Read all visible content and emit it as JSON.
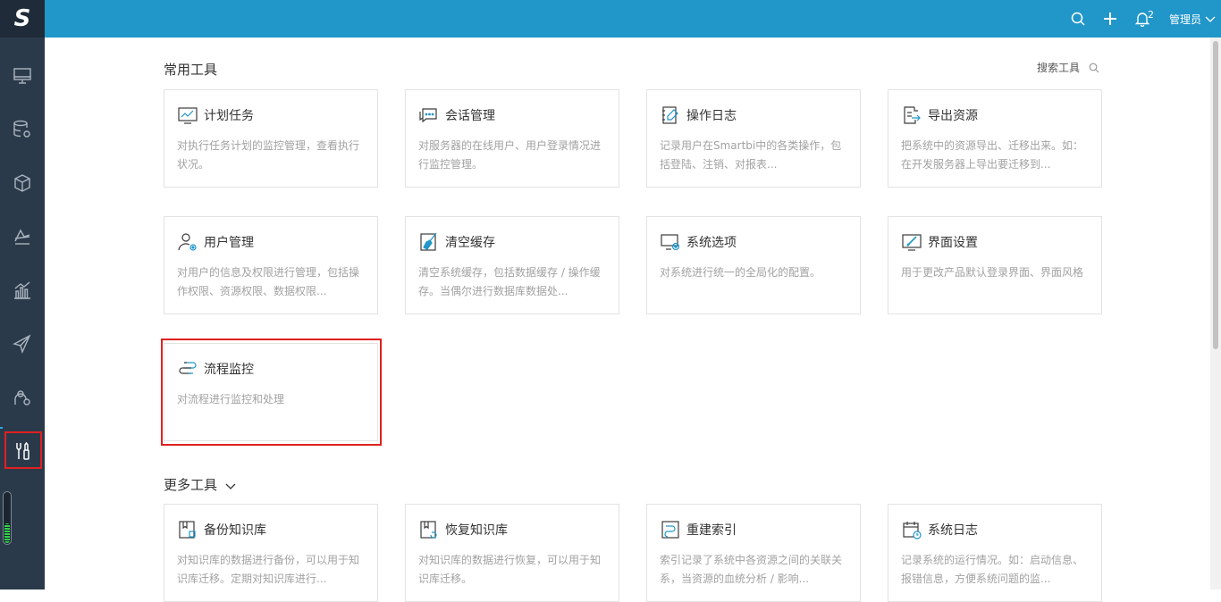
{
  "logo": "S",
  "topbar": {
    "user_name": "管理员",
    "notification_count": "2"
  },
  "sidebar": {
    "items": [
      {
        "name": "monitor-icon"
      },
      {
        "name": "database-settings-icon"
      },
      {
        "name": "cube-icon"
      },
      {
        "name": "analysis-icon"
      },
      {
        "name": "bar-chart-icon"
      },
      {
        "name": "paper-plane-icon"
      },
      {
        "name": "user-graph-icon"
      },
      {
        "name": "tools-icon"
      }
    ]
  },
  "common_tools": {
    "title": "常用工具",
    "search_label": "搜索工具",
    "cards": [
      {
        "title": "计划任务",
        "desc": "对执行任务计划的监控管理，查看执行状况。",
        "icon": "chart-screen-icon"
      },
      {
        "title": "会话管理",
        "desc": "对服务器的在线用户、用户登录情况进行监控管理。",
        "icon": "chat-icon"
      },
      {
        "title": "操作日志",
        "desc": "记录用户在Smartbi中的各类操作，包括登陆、注销、对报表...",
        "icon": "notebook-pen-icon"
      },
      {
        "title": "导出资源",
        "desc": "把系统中的资源导出、迁移出来。如：在开发服务器上导出要迁移到...",
        "icon": "export-icon"
      },
      {
        "title": "用户管理",
        "desc": "对用户的信息及权限进行管理，包括操作权限、资源权限、数据权限...",
        "icon": "user-gear-icon"
      },
      {
        "title": "清空缓存",
        "desc": "清空系统缓存，包括数据缓存 / 操作缓存。当偶尔进行数据库数据处...",
        "icon": "broom-icon"
      },
      {
        "title": "系统选项",
        "desc": "对系统进行统一的全局化的配置。",
        "icon": "screen-gear-icon"
      },
      {
        "title": "界面设置",
        "desc": "用于更改产品默认登录界面、界面风格",
        "icon": "screen-brush-icon"
      },
      {
        "title": "流程监控",
        "desc": "对流程进行监控和处理",
        "icon": "flow-icon"
      }
    ]
  },
  "more_tools": {
    "title": "更多工具",
    "cards": [
      {
        "title": "备份知识库",
        "desc": "对知识库的数据进行备份，可以用于知识库迁移。定期对知识库进行...",
        "icon": "backup-icon"
      },
      {
        "title": "恢复知识库",
        "desc": "对知识库的数据进行恢复，可以用于知识库迁移。",
        "icon": "restore-icon"
      },
      {
        "title": "重建索引",
        "desc": "索引记录了系统中各资源之间的关联关系，当资源的血统分析 / 影响...",
        "icon": "index-icon"
      },
      {
        "title": "系统日志",
        "desc": "记录系统的运行情况。如：启动信息、报错信息，方便系统问题的监...",
        "icon": "calendar-clock-icon"
      }
    ]
  }
}
